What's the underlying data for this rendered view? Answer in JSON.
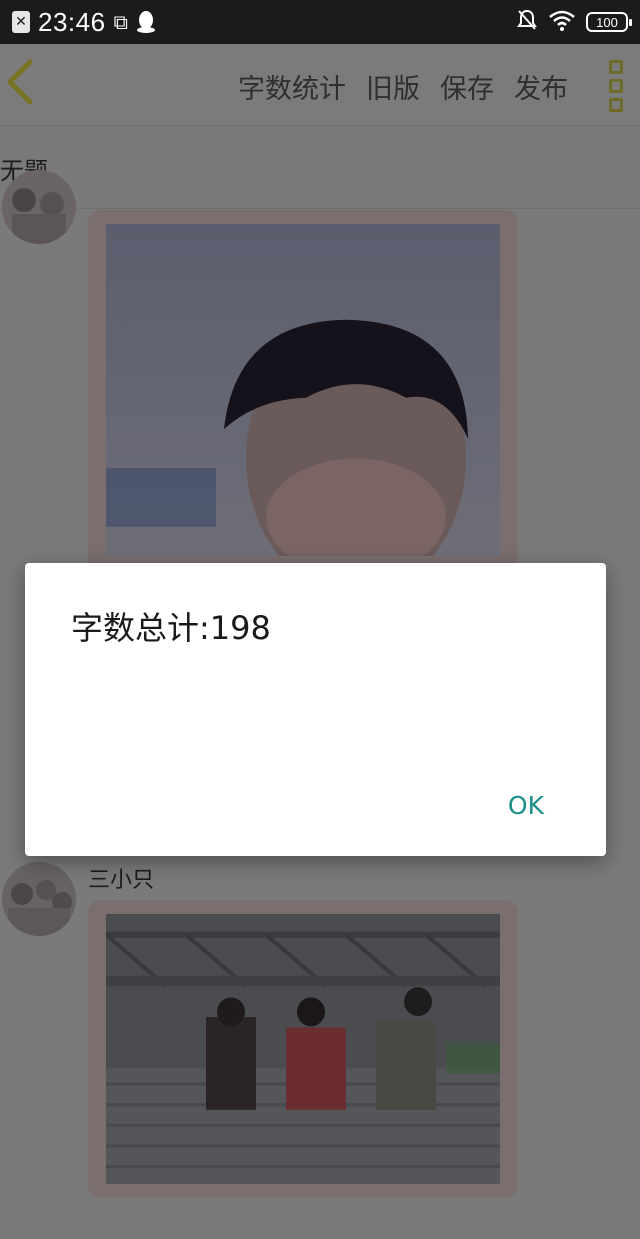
{
  "status_bar": {
    "time": "23:46",
    "battery": "100",
    "left_icons": [
      "close-box-icon",
      "screenshot-icon",
      "qq-penguin-icon"
    ],
    "right_icons": [
      "bell-muted-icon",
      "wifi-icon",
      "battery-icon"
    ]
  },
  "toolbar": {
    "actions": [
      "字数统计",
      "旧版",
      "保存",
      "发布"
    ]
  },
  "document": {
    "title": "无题"
  },
  "posts": [
    {
      "author": ""
    },
    {
      "author": "三小只"
    }
  ],
  "dialog": {
    "message": "字数总计:198",
    "ok_label": "OK"
  },
  "colors": {
    "dialog_button": "#1a8f89",
    "back_chevron": "#7a7324",
    "dim_overlay": "#7a7a7a"
  }
}
